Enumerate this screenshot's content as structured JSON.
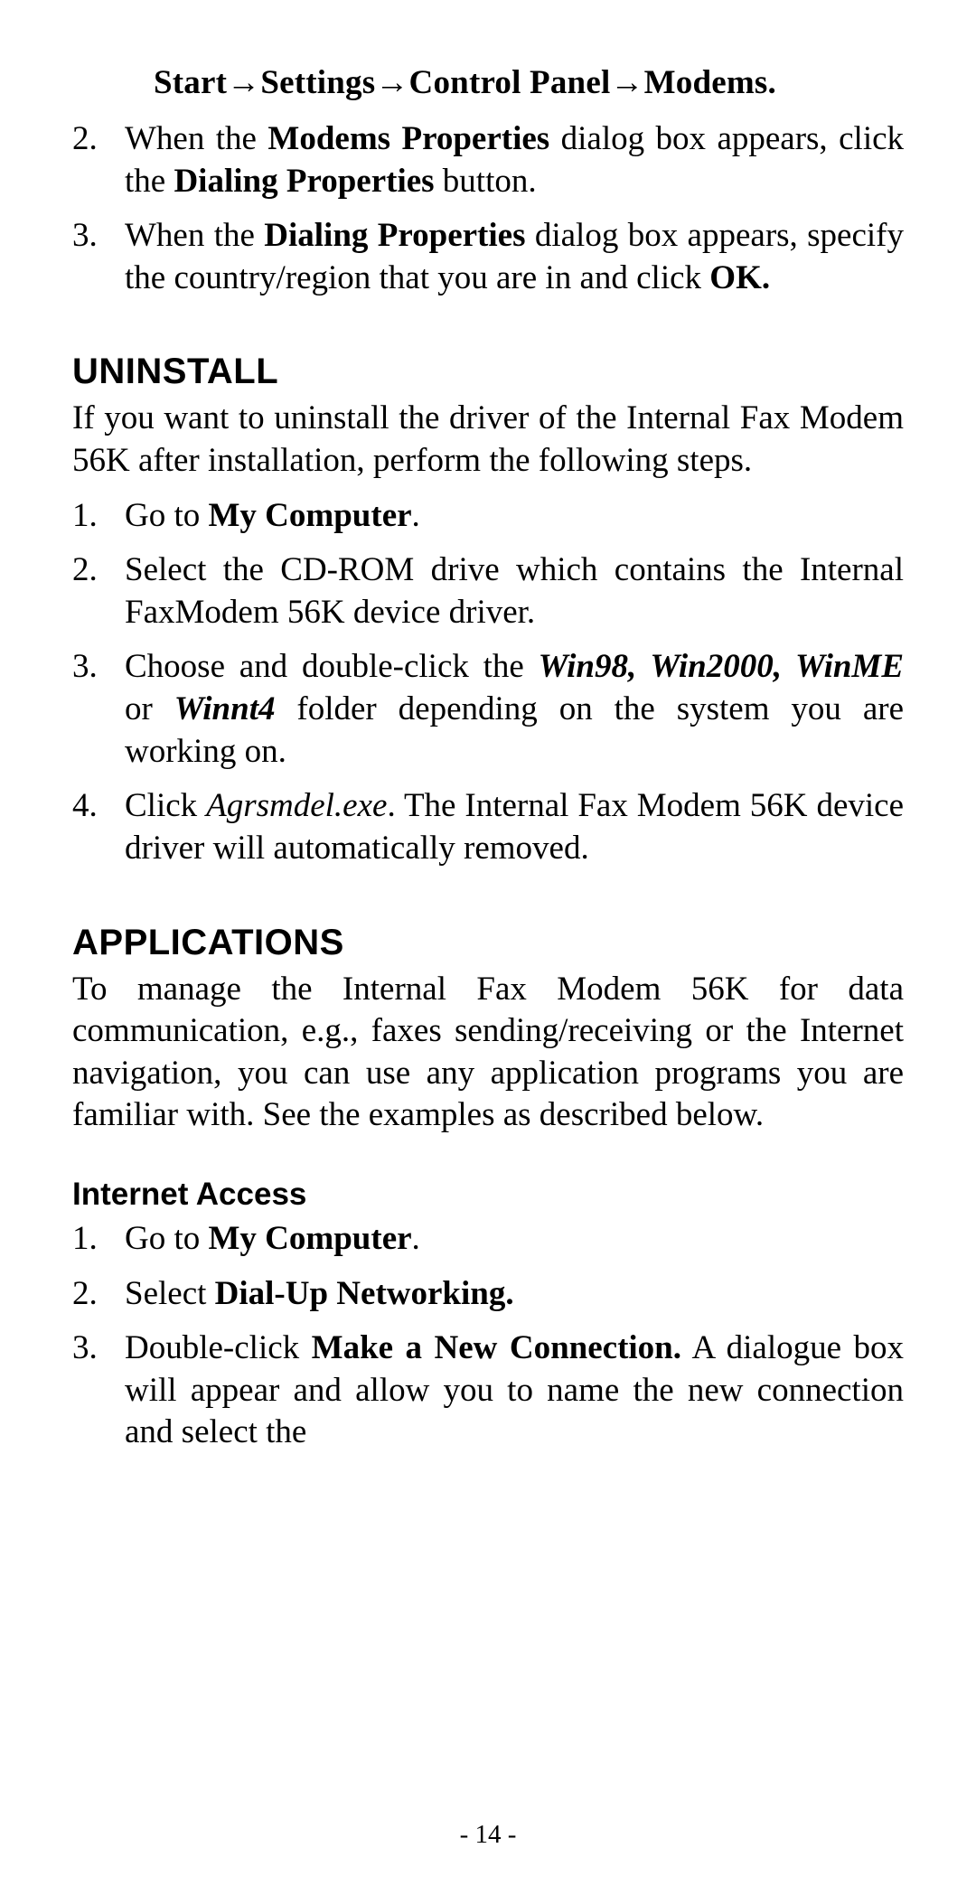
{
  "navPath": "Start→Settings→Control Panel→Modems.",
  "topSteps": {
    "item2": {
      "num": "2.",
      "t1": "When  the  ",
      "b1": "Modems  Properties",
      "t2": "  dialog  box appears, click the ",
      "b2": "Dialing Properties",
      "t3": " button."
    },
    "item3": {
      "num": "3.",
      "t1": "When  the  ",
      "b1": "Dialing  Properties",
      "t2": "  dialog  box appears, specify the country/region that you are in and click ",
      "b2": "OK.",
      "t3": ""
    }
  },
  "uninstall": {
    "heading": "UNINSTALL",
    "intro": "If you want to uninstall the driver of the Internal Fax Modem 56K after installation, perform the following steps.",
    "steps": {
      "s1": {
        "num": "1.",
        "t1": "Go to ",
        "b1": "My Computer",
        "t2": "."
      },
      "s2": {
        "num": "2.",
        "t1": "Select the CD-ROM drive which contains the Internal FaxModem 56K device driver."
      },
      "s3": {
        "num": "3.",
        "t1": "Choose    and    double-click    the    ",
        "i1": "Win98, Win2000,   WinME",
        "t2": "   or   ",
        "i2": "Winnt4",
        "t3": "   folder depending on the system you are working on."
      },
      "s4": {
        "num": "4.",
        "t1": "Click ",
        "i1": "Agrsmdel.exe",
        "t2": ".    The Internal Fax Modem 56K   device   driver   will   automatically removed."
      }
    }
  },
  "applications": {
    "heading": "APPLICATIONS",
    "intro": "To manage the Internal Fax Modem 56K for data communication, e.g., faxes sending/receiving or the Internet navigation, you can use any application programs you are familiar with.    See the examples as described below."
  },
  "internet": {
    "heading": "Internet Access",
    "steps": {
      "s1": {
        "num": "1.",
        "t1": "Go to ",
        "b1": "My Computer",
        "t2": "."
      },
      "s2": {
        "num": "2.",
        "t1": "Select ",
        "b1": "Dial-Up Networking.",
        "t2": ""
      },
      "s3": {
        "num": "3.",
        "t1": "Double-click ",
        "b1": "Make a New Connection.",
        "t2": "    A dialogue box will appear and allow you to name the new connection and select the"
      }
    }
  },
  "footer": "- 14 -"
}
